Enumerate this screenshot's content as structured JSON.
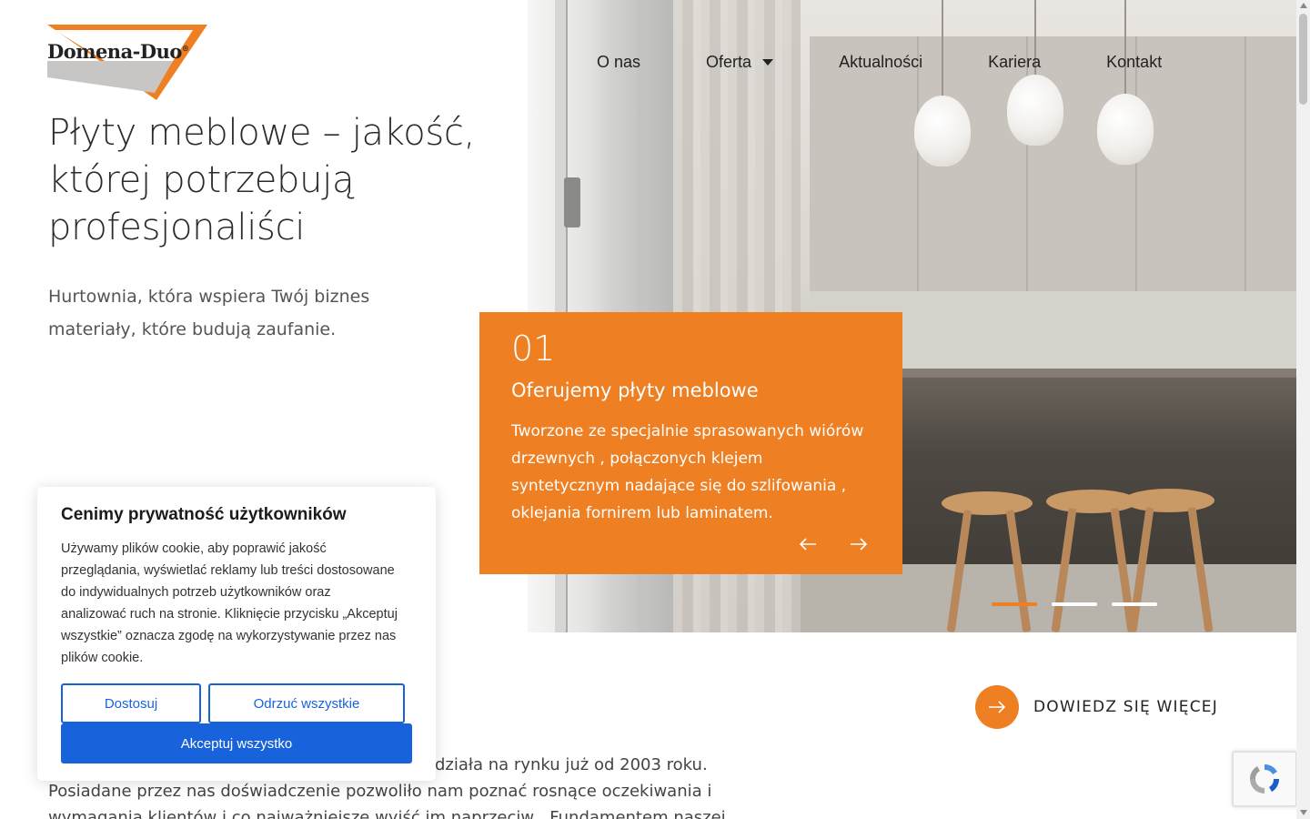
{
  "brand": {
    "logo_text": "Domena-Duo",
    "registered_mark": "®",
    "accent_color": "#ee7f22",
    "logo_grey": "#c8c6c4"
  },
  "nav": {
    "items": [
      {
        "label": "O nas"
      },
      {
        "label": "Oferta",
        "has_dropdown": true
      },
      {
        "label": "Aktualności"
      },
      {
        "label": "Kariera"
      },
      {
        "label": "Kontakt"
      }
    ]
  },
  "hero": {
    "title": "Płyty meblowe – jakość, której potrzebują profesjonaliści",
    "subtitle_line1": "Hurtownia, która wspiera Twój biznes",
    "subtitle_line2": "materiały, które budują zaufanie.",
    "slider": {
      "number": "01",
      "title": "Oferujemy płyty meblowe",
      "text": "Tworzone ze specjalnie sprasowanych wiórów drzewnych , połączonych klejem syntetycznym nadające się do szlifowania , oklejania fornirem lub laminatem.",
      "prev_icon": "arrow-left-icon",
      "next_icon": "arrow-right-icon",
      "slide_count": 3,
      "active_index": 0
    }
  },
  "read_more": {
    "label": "DOWIEDZ SIĘ WIĘCEJ",
    "icon": "arrow-right-icon"
  },
  "about": {
    "line1": "działa na rynku już od 2003 roku.",
    "line2": "Posiadane przez nas doświadczenie pozwoliło nam poznać rosnące oczekiwania i",
    "line3": "wymagania klientów i co najważniejsze wyjść im naprzeciw . Fundamentem naszej"
  },
  "cookie": {
    "title": "Cenimy prywatność użytkowników",
    "text": "Używamy plików cookie, aby poprawić jakość przeglądania, wyświetlać reklamy lub treści dostosowane do indywidualnych potrzeb użytkowników oraz analizować ruch na stronie. Kliknięcie przycisku „Akceptuj wszystkie” oznacza zgodę na wykorzystywanie przez nas plików cookie.",
    "customize_label": "Dostosuj",
    "reject_label": "Odrzuć wszystkie",
    "accept_label": "Akceptuj wszystko",
    "button_color": "#1863dc"
  }
}
